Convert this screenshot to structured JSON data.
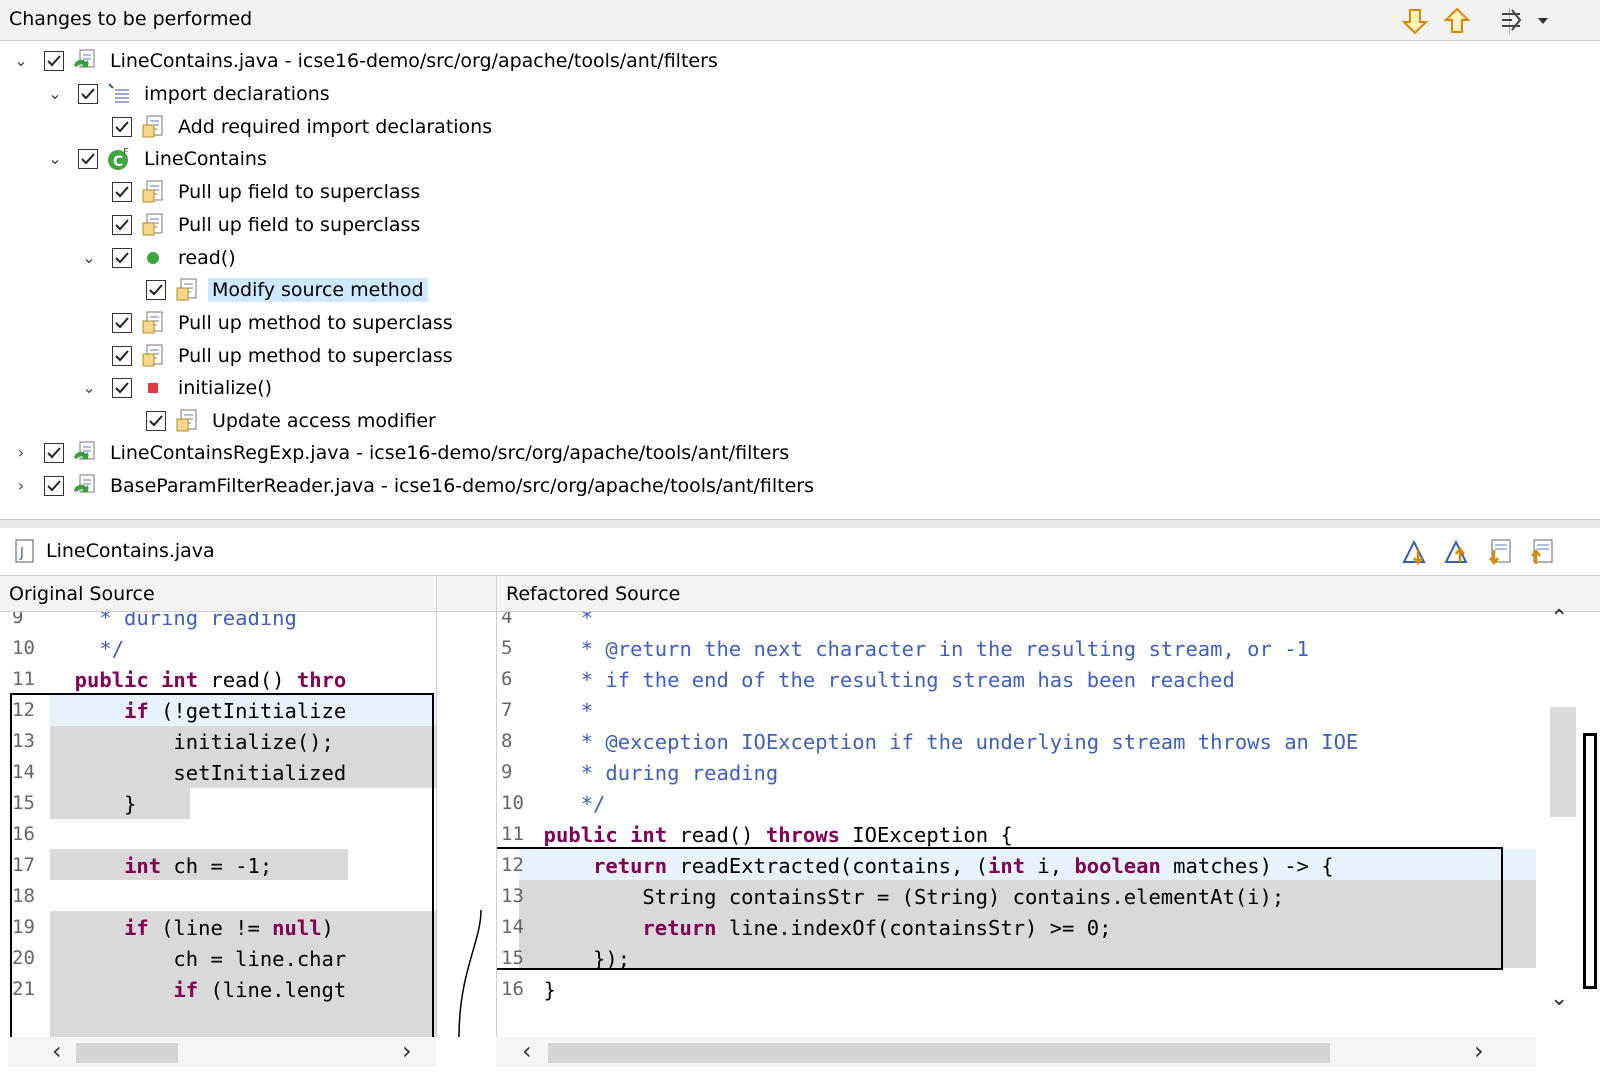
{
  "top_pane": {
    "title": "Changes to be performed",
    "toolbar": {
      "next_icon": "arrow-down-icon",
      "prev_icon": "arrow-up-icon",
      "filter_icon": "filter-menu-icon"
    },
    "tree": [
      {
        "label": "LineContains.java - icse16-demo/src/org/apache/tools/ant/filters",
        "icon": "java-file-change-icon",
        "expanded": true
      },
      {
        "label": "import declarations",
        "icon": "imports-icon",
        "expanded": true
      },
      {
        "label": "Add required import declarations",
        "icon": "change-icon"
      },
      {
        "label": "LineContains",
        "icon": "class-icon",
        "expanded": true
      },
      {
        "label": "Pull up field to superclass",
        "icon": "change-icon"
      },
      {
        "label": "Pull up field to superclass",
        "icon": "change-icon"
      },
      {
        "label": "read()",
        "icon": "public-method-icon",
        "expanded": true
      },
      {
        "label": "Modify source method",
        "icon": "change-icon",
        "selected": true
      },
      {
        "label": "Pull up method to superclass",
        "icon": "change-icon"
      },
      {
        "label": "Pull up method to superclass",
        "icon": "change-icon"
      },
      {
        "label": "initialize()",
        "icon": "private-method-icon",
        "expanded": true
      },
      {
        "label": "Update access modifier",
        "icon": "change-icon"
      },
      {
        "label": "LineContainsRegExp.java - icse16-demo/src/org/apache/tools/ant/filters",
        "icon": "java-file-change-icon",
        "expanded": false
      },
      {
        "label": "BaseParamFilterReader.java - icse16-demo/src/org/apache/tools/ant/filters",
        "icon": "java-file-change-icon",
        "expanded": false
      }
    ]
  },
  "compare": {
    "file_name": "LineContains.java",
    "toolbar_icons": [
      "next-difference-icon",
      "previous-difference-icon",
      "next-change-icon",
      "previous-change-icon"
    ],
    "left_title": "Original Source",
    "right_title": "Refactored Source",
    "left_lines": [
      {
        "n": "9",
        "text": "    * during reading"
      },
      {
        "n": "10",
        "text": "    */"
      },
      {
        "n": "11",
        "text": "  public int read() thro"
      },
      {
        "n": "12",
        "text": "      if (!getInitialize"
      },
      {
        "n": "13",
        "text": "          initialize();"
      },
      {
        "n": "14",
        "text": "          setInitialized"
      },
      {
        "n": "15",
        "text": "      }"
      },
      {
        "n": "16",
        "text": ""
      },
      {
        "n": "17",
        "text": "      int ch = -1;"
      },
      {
        "n": "18",
        "text": ""
      },
      {
        "n": "19",
        "text": "      if (line != null)"
      },
      {
        "n": "20",
        "text": "          ch = line.char"
      },
      {
        "n": "21",
        "text": "          if (line.lengt"
      }
    ],
    "right_lines": [
      {
        "n": "4",
        "text": "     *"
      },
      {
        "n": "5",
        "text": "     * @return the next character in the resulting stream, or -1"
      },
      {
        "n": "6",
        "text": "     * if the end of the resulting stream has been reached"
      },
      {
        "n": "7",
        "text": "     *"
      },
      {
        "n": "8",
        "text": "     * @exception IOException if the underlying stream throws an IOE"
      },
      {
        "n": "9",
        "text": "     * during reading"
      },
      {
        "n": "10",
        "text": "     */"
      },
      {
        "n": "11",
        "text": "  public int read() throws IOException {"
      },
      {
        "n": "12",
        "text": "      return readExtracted(contains, (int i, boolean matches) -> {"
      },
      {
        "n": "13",
        "text": "          String containsStr = (String) contains.elementAt(i);"
      },
      {
        "n": "14",
        "text": "          return line.indexOf(containsStr) >= 0;"
      },
      {
        "n": "15",
        "text": "      });"
      },
      {
        "n": "16",
        "text": "  }"
      }
    ]
  }
}
